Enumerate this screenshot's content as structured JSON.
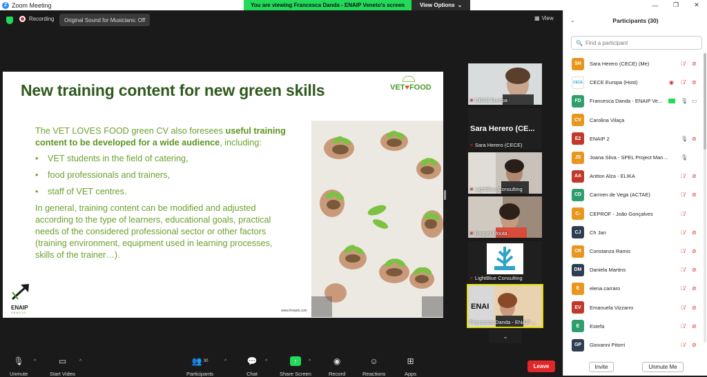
{
  "window": {
    "title": "Zoom Meeting",
    "minimize": "—",
    "maximize": "❐",
    "close": "✕"
  },
  "banner": {
    "message": "You are viewing Francesca Danda - ENAIP Veneto's screen",
    "view_options": "View Options"
  },
  "topbar": {
    "recording": "Recording",
    "original_sound": "Original Sound for Musicians: Off",
    "view": "View"
  },
  "slide": {
    "title": "New training content for new green skills",
    "logo": {
      "vet": "VET",
      "heart": "♥",
      "food": "FOOD"
    },
    "intro_plain": "The VET LOVES FOOD green CV also foresees ",
    "intro_bold": "useful training content to be developed for a wide audience",
    "intro_end": ", including:",
    "bullets": [
      "VET students in the field of catering,",
      "food professionals and trainers,",
      "staff of VET centres."
    ],
    "closing": "In general, training content can be modified and adjusted according to the type of learners, educational goals, practical needs of the considered professional sector or other factors (training environment, equipment used in learning processes, skills of the trainer…).",
    "credit": "www.freepik.com",
    "enaip": "ENAIP",
    "enaip_sub": "VENETO"
  },
  "thumbnails": [
    {
      "name": "CECE Europa",
      "muted": true
    },
    {
      "name": "Sara Herero (CECE)",
      "big_label": "Sara Herero (CE...",
      "muted": true
    },
    {
      "name": "LightBlue Consulting",
      "muted": true
    },
    {
      "name": "Raquel Mouta",
      "muted": true
    },
    {
      "name": "LightBlue Consulting",
      "muted": true
    },
    {
      "name": "Francesca Danda - ENAIP ...",
      "muted": false
    }
  ],
  "toolbar": {
    "unmute": "Unmute",
    "start_video": "Start Video",
    "participants": "Participants",
    "participants_count": "30",
    "chat": "Chat",
    "share_screen": "Share Screen",
    "record": "Record",
    "reactions": "Reactions",
    "apps": "Apps",
    "leave": "Leave"
  },
  "panel": {
    "title": "Participants (30)",
    "search_placeholder": "Find a participant",
    "invite": "Invite",
    "unmute_me": "Unmute Me",
    "participants": [
      {
        "initials": "SH",
        "color": "#e8961e",
        "name": "Sara Herero (CECE) (Me)",
        "mic": "muted",
        "video": "off"
      },
      {
        "initials": "CECE",
        "color": "#ffffff",
        "name": "CECE Europa (Host)",
        "mic": "muted",
        "video": "off",
        "recording": true
      },
      {
        "initials": "FD",
        "color": "#2f9e6d",
        "name": "Francesca Danda - ENAIP Ve...",
        "mic": "on",
        "video": "on",
        "sharing": true
      },
      {
        "initials": "CV",
        "color": "#e8961e",
        "name": "Carolina Vilaça",
        "mic": "none",
        "video": "none"
      },
      {
        "initials": "E2",
        "color": "#c0392b",
        "name": "ENAIP 2",
        "mic": "on",
        "video": "off"
      },
      {
        "initials": "JS",
        "color": "#e8961e",
        "name": "Joana Silva - SPEL Project Manageme...",
        "mic": "on",
        "video": "none"
      },
      {
        "initials": "AA",
        "color": "#c0392b",
        "name": "Antton Alza - ELIKA",
        "mic": "muted",
        "video": "off"
      },
      {
        "initials": "CD",
        "color": "#2f9e6d",
        "name": "Carmen de Vega (ACTAE)",
        "mic": "muted",
        "video": "off"
      },
      {
        "initials": "C-",
        "color": "#e8961e",
        "name": "CEPROF - João Gonçalves",
        "mic": "muted",
        "video": "none"
      },
      {
        "initials": "CJ",
        "color": "#2c3e50",
        "name": "Ch Jan",
        "mic": "muted",
        "video": "off"
      },
      {
        "initials": "CR",
        "color": "#e8961e",
        "name": "Constanza Ramis",
        "mic": "muted",
        "video": "off"
      },
      {
        "initials": "DM",
        "color": "#2c3e50",
        "name": "Daniela Martins",
        "mic": "muted",
        "video": "off"
      },
      {
        "initials": "E",
        "color": "#e8961e",
        "name": "elena.carraro",
        "mic": "muted",
        "video": "off"
      },
      {
        "initials": "EV",
        "color": "#c0392b",
        "name": "Emanuela Vizzarro",
        "mic": "muted",
        "video": "off"
      },
      {
        "initials": "E",
        "color": "#2f9e6d",
        "name": "Estefa",
        "mic": "muted",
        "video": "off"
      },
      {
        "initials": "GP",
        "color": "#2c3e50",
        "name": "Giovanni Pitorri",
        "mic": "muted",
        "video": "off"
      }
    ]
  }
}
